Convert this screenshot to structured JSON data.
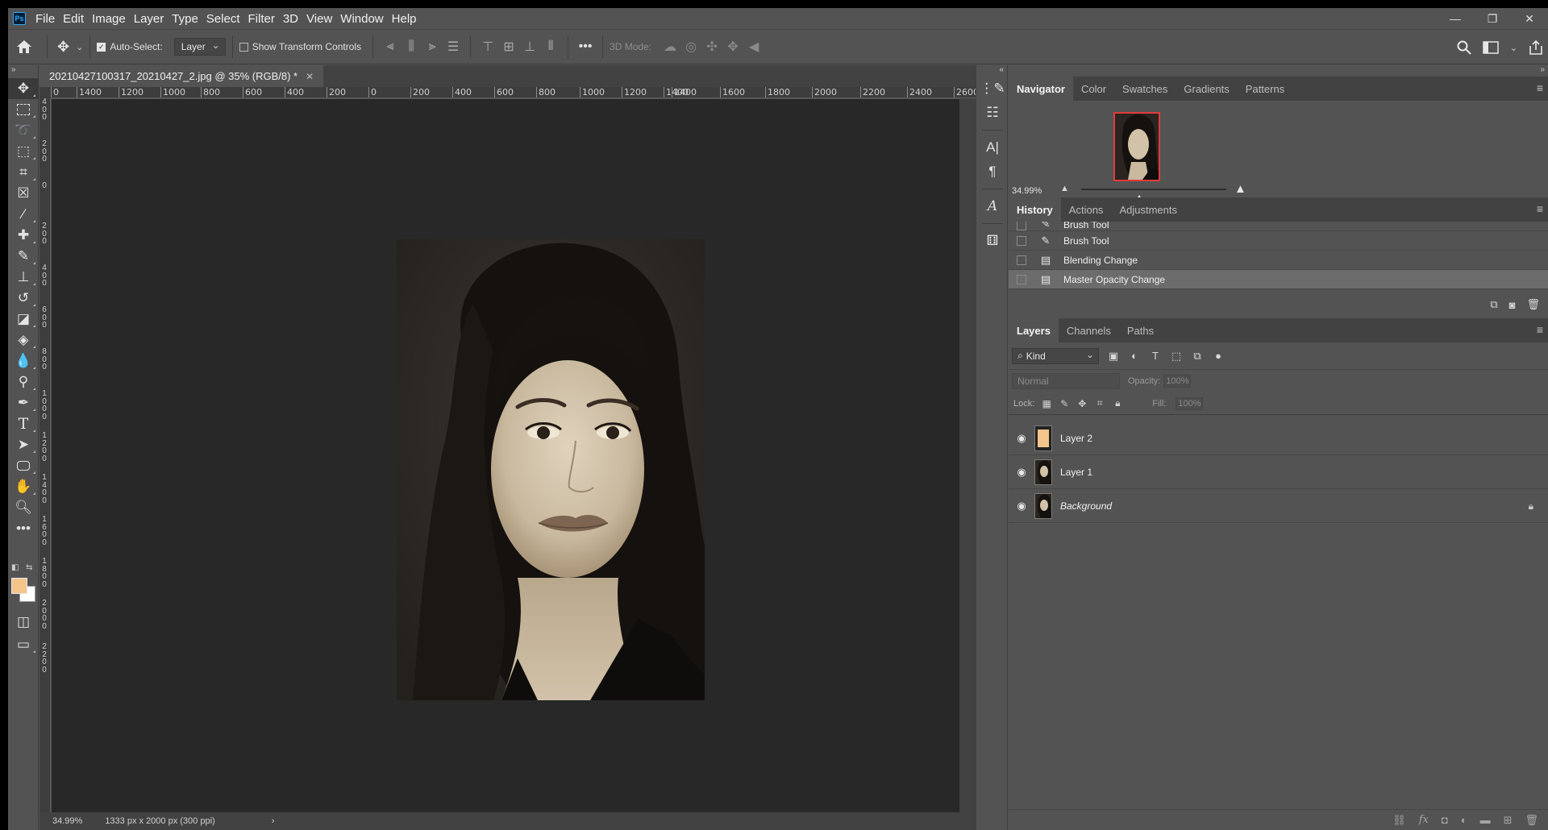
{
  "app": {
    "logo_text": "Ps",
    "menu": [
      "File",
      "Edit",
      "Image",
      "Layer",
      "Type",
      "Select",
      "Filter",
      "3D",
      "View",
      "Window",
      "Help"
    ]
  },
  "window_controls": {
    "minimize": "—",
    "restore": "❐",
    "close": "✕"
  },
  "options_bar": {
    "auto_select_label": "Auto-Select:",
    "auto_select_checked": true,
    "auto_select_target": "Layer",
    "show_transform_label": "Show Transform Controls",
    "mode_3d_label": "3D Mode:",
    "more_label": "•••"
  },
  "document": {
    "tab_title": "20210427100317_20210427_2.jpg @ 35% (RGB/8) *",
    "ruler_h": [
      "0",
      "1400",
      "1200",
      "1000",
      "800",
      "600",
      "400",
      "200",
      "0",
      "200",
      "400",
      "600",
      "800",
      "1000",
      "1200",
      "1400",
      "1400",
      "1600",
      "1800",
      "2000",
      "2200",
      "2400",
      "2600"
    ],
    "ruler_v": [
      "4 0 0",
      "2 0 0",
      "0",
      "2 0 0",
      "4 0 0",
      "6 0 0",
      "8 0 0",
      "1 0 0 0",
      "1 2 0 0",
      "1 4 0 0",
      "1 6 0 0",
      "1 8 0 0",
      "2 0 0 0",
      "2 2 0 0"
    ],
    "status_zoom": "34.99%",
    "status_info": "1333 px x 2000 px (300 ppi)",
    "status_arrow": "›"
  },
  "colors": {
    "foreground": "#f4c58a",
    "background": "#ffffff",
    "accent": "#31a8ff",
    "nav_frame": "#e03b3b"
  },
  "navigator": {
    "tabs": [
      "Navigator",
      "Color",
      "Swatches",
      "Gradients",
      "Patterns"
    ],
    "active_tab": "Navigator",
    "zoom": "34.99%",
    "zoom_slider_level": 0.4
  },
  "history": {
    "tabs": [
      "History",
      "Actions",
      "Adjustments"
    ],
    "active_tab": "History",
    "items": [
      {
        "label": "Brush Tool",
        "icon": "brush-icon"
      },
      {
        "label": "Brush Tool",
        "icon": "brush-icon"
      },
      {
        "label": "Blending Change",
        "icon": "document-icon"
      },
      {
        "label": "Master Opacity Change",
        "icon": "document-icon",
        "selected": true
      }
    ]
  },
  "layers": {
    "tabs": [
      "Layers",
      "Channels",
      "Paths"
    ],
    "active_tab": "Layers",
    "filter_kind": "Kind",
    "blend_mode": "Normal",
    "opacity_label": "Opacity:",
    "opacity_value": "100%",
    "lock_label": "Lock:",
    "fill_label": "Fill:",
    "fill_value": "100%",
    "items": [
      {
        "name": "Layer 2",
        "thumb": "orange"
      },
      {
        "name": "Layer 1",
        "thumb": "photo"
      },
      {
        "name": "Background",
        "thumb": "photo",
        "italic": true,
        "locked": true
      }
    ]
  },
  "icons": {
    "home": "⌂",
    "move": "✥",
    "search": "⌕",
    "eye": "👁",
    "lock": "🔒",
    "menu": "≡",
    "trash": "🗑",
    "camera": "📷"
  }
}
